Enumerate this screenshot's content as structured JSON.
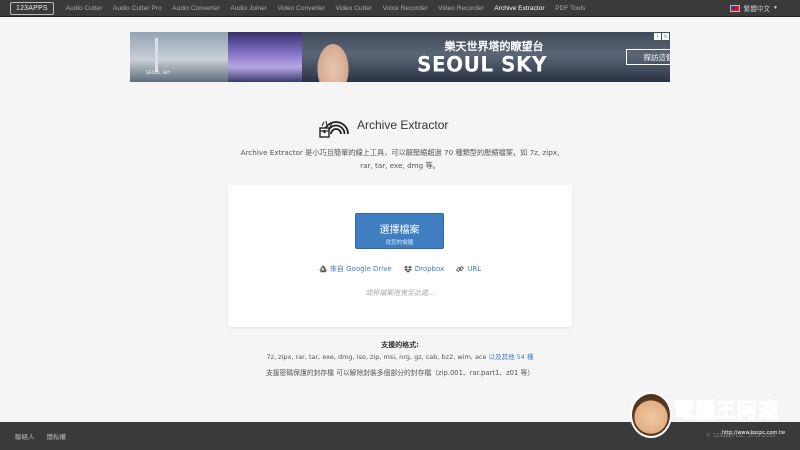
{
  "topnav": {
    "logo": "123APPS",
    "links": [
      {
        "label": "Audio Cutter",
        "active": false
      },
      {
        "label": "Audio Cutter Pro",
        "active": false
      },
      {
        "label": "Audio Converter",
        "active": false
      },
      {
        "label": "Audio Joiner",
        "active": false
      },
      {
        "label": "Video Converter",
        "active": false
      },
      {
        "label": "Video Cutter",
        "active": false
      },
      {
        "label": "Voice Recorder",
        "active": false
      },
      {
        "label": "Video Recorder",
        "active": false
      },
      {
        "label": "Archive Extractor",
        "active": true
      },
      {
        "label": "PDF Tools",
        "active": false
      }
    ],
    "language": "繁體中文"
  },
  "ad": {
    "small_label": "SEOUL SKY",
    "headline": "樂天世界塔的瞭望台",
    "title": "SEOUL SKY",
    "cta": "探訪這個地方"
  },
  "brand": {
    "name": "Archive Extractor",
    "icon": "archive-rainbow-icon"
  },
  "description": "Archive Extractor 是小巧且簡單的線上工具，可以解壓縮超過 70 種類型的壓縮檔案，如 7z, zipx, rar, tar, exe, dmg 等。",
  "upload": {
    "button_label": "選擇檔案",
    "button_sublabel": "從您的電腦",
    "sources": [
      {
        "label": "來自 Google Drive",
        "icon": "google-drive-icon"
      },
      {
        "label": "Dropbox",
        "icon": "dropbox-icon"
      },
      {
        "label": "URL",
        "icon": "link-icon"
      }
    ],
    "drop_hint": "或將檔案拖曳至此處..."
  },
  "supported": {
    "title": "支援的格式:",
    "formats": "7z, zipx, rar, tar, exe, dmg, iso, zip, msi, nrg, gz, cab, bz2, wim, ace",
    "more_link": "以及其他 54 種",
    "note": "支援密碼保護的封存檔 可以解除封裝多個部分的封存檔（zip.001、rar.part1、z01 等）"
  },
  "footer": {
    "links": [
      "聯絡人",
      "隱私權"
    ],
    "copyright": "© 123apps LLC, 2012-2019"
  },
  "watermark": {
    "text": "電腦王阿達",
    "url": "http://www.kocpc.com.tw"
  }
}
